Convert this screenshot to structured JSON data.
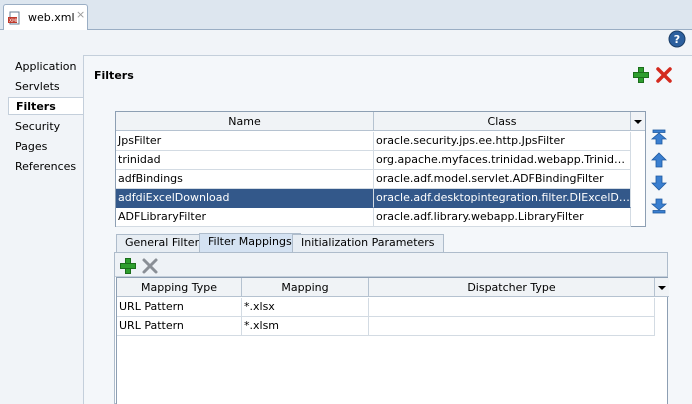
{
  "editor_tab": {
    "label": "web.xml",
    "close": "×"
  },
  "nav": {
    "items": [
      {
        "label": "Application",
        "selected": false
      },
      {
        "label": "Servlets",
        "selected": false
      },
      {
        "label": "Filters",
        "selected": true
      },
      {
        "label": "Security",
        "selected": false
      },
      {
        "label": "Pages",
        "selected": false
      },
      {
        "label": "References",
        "selected": false
      }
    ]
  },
  "section": {
    "title": "Filters"
  },
  "filters_table": {
    "columns": [
      "Name",
      "Class"
    ],
    "rows": [
      {
        "name": "JpsFilter",
        "class": "oracle.security.jps.ee.http.JpsFilter",
        "selected": false
      },
      {
        "name": "trinidad",
        "class": "org.apache.myfaces.trinidad.webapp.TrinidadFilter",
        "selected": false
      },
      {
        "name": "adfBindings",
        "class": "oracle.adf.model.servlet.ADFBindingFilter",
        "selected": false
      },
      {
        "name": "adfdiExcelDownload",
        "class": "oracle.adf.desktopintegration.filter.DIExcelDownl…",
        "selected": true
      },
      {
        "name": "ADFLibraryFilter",
        "class": "oracle.adf.library.webapp.LibraryFilter",
        "selected": false
      }
    ]
  },
  "subtabs": [
    {
      "label": "General Filter",
      "active": false
    },
    {
      "label": "Filter Mappings",
      "active": true
    },
    {
      "label": "Initialization Parameters",
      "active": false
    }
  ],
  "mappings_table": {
    "columns": [
      "Mapping Type",
      "Mapping",
      "Dispatcher Type"
    ],
    "rows": [
      {
        "type": "URL Pattern",
        "mapping": "*.xlsx",
        "dispatcher": ""
      },
      {
        "type": "URL Pattern",
        "mapping": "*.xlsm",
        "dispatcher": ""
      }
    ]
  },
  "icons": {
    "file": "xml-file-icon",
    "help": "help-icon",
    "add": "add-icon",
    "delete": "delete-icon",
    "move_top": "move-top-icon",
    "move_up": "move-up-icon",
    "move_down": "move-down-icon",
    "move_bottom": "move-bottom-icon",
    "dropdown": "dropdown-icon"
  },
  "colors": {
    "selection": "#33588a",
    "add": "#2e9e2e",
    "delete": "#d42a1e",
    "arrow": "#3a7fd0"
  }
}
